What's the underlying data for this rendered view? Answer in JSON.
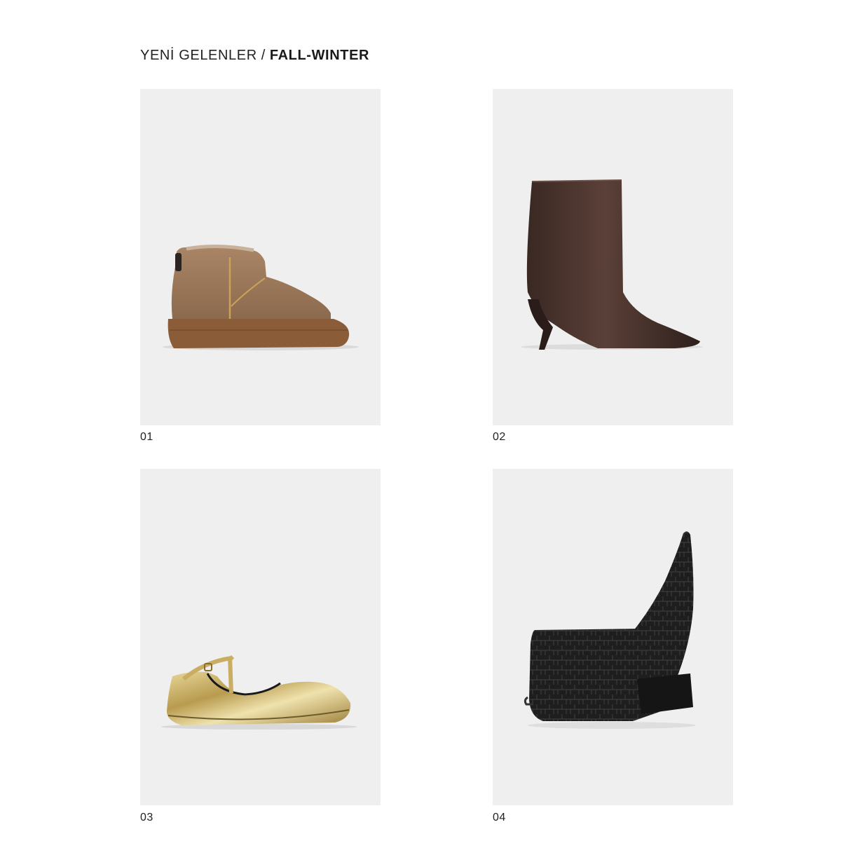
{
  "breadcrumb": {
    "parent": "YENİ GELENLER",
    "separator": "/",
    "current": "FALL-WINTER"
  },
  "products": [
    {
      "number": "01",
      "image": "tan-suede-platform-ankle-boot"
    },
    {
      "number": "02",
      "image": "dark-brown-leather-kitten-heel-boot"
    },
    {
      "number": "03",
      "image": "gold-metallic-t-bar-ballet-flat"
    },
    {
      "number": "04",
      "image": "black-croc-embossed-block-heel-boot"
    }
  ],
  "colors": {
    "background": "#ffffff",
    "card_background": "#efefef",
    "text": "#1c1c1c"
  }
}
